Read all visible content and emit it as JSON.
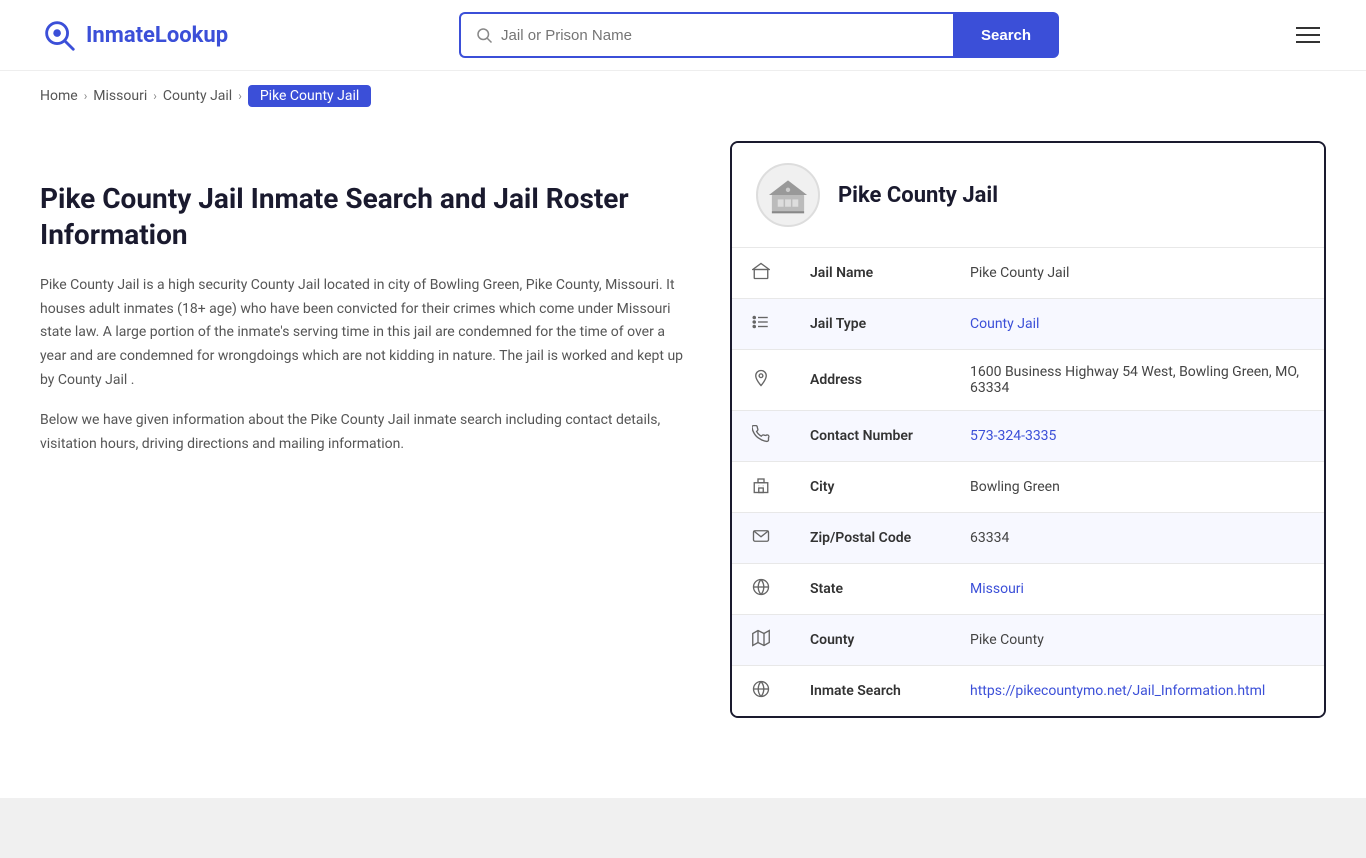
{
  "logo": {
    "text_part1": "Inmate",
    "text_part2": "Lookup"
  },
  "search": {
    "placeholder": "Jail or Prison Name",
    "button_label": "Search"
  },
  "breadcrumb": {
    "items": [
      {
        "label": "Home",
        "href": "#"
      },
      {
        "label": "Missouri",
        "href": "#"
      },
      {
        "label": "County Jail",
        "href": "#"
      },
      {
        "label": "Pike County Jail",
        "active": true
      }
    ]
  },
  "left": {
    "heading": "Pike County Jail Inmate Search and Jail Roster Information",
    "para1": "Pike County Jail is a high security County Jail located in city of Bowling Green, Pike County, Missouri. It houses adult inmates (18+ age) who have been convicted for their crimes which come under Missouri state law. A large portion of the inmate's serving time in this jail are condemned for the time of over a year and are condemned for wrongdoings which are not kidding in nature. The jail is worked and kept up by County Jail .",
    "para2": "Below we have given information about the Pike County Jail inmate search including contact details, visitation hours, driving directions and mailing information."
  },
  "card": {
    "title": "Pike County Jail",
    "rows": [
      {
        "label": "Jail Name",
        "value": "Pike County Jail",
        "link": null,
        "icon": "building"
      },
      {
        "label": "Jail Type",
        "value": "County Jail",
        "link": "#",
        "icon": "list"
      },
      {
        "label": "Address",
        "value": "1600 Business Highway 54 West, Bowling Green, MO, 63334",
        "link": null,
        "icon": "pin"
      },
      {
        "label": "Contact Number",
        "value": "573-324-3335",
        "link": "tel:573-324-3335",
        "icon": "phone"
      },
      {
        "label": "City",
        "value": "Bowling Green",
        "link": null,
        "icon": "city"
      },
      {
        "label": "Zip/Postal Code",
        "value": "63334",
        "link": null,
        "icon": "mail"
      },
      {
        "label": "State",
        "value": "Missouri",
        "link": "#",
        "icon": "globe"
      },
      {
        "label": "County",
        "value": "Pike County",
        "link": null,
        "icon": "map"
      },
      {
        "label": "Inmate Search",
        "value": "https://pikecountymo.net/Jail_Information.html",
        "link": "https://pikecountymo.net/Jail_Information.html",
        "icon": "globe2"
      }
    ]
  }
}
